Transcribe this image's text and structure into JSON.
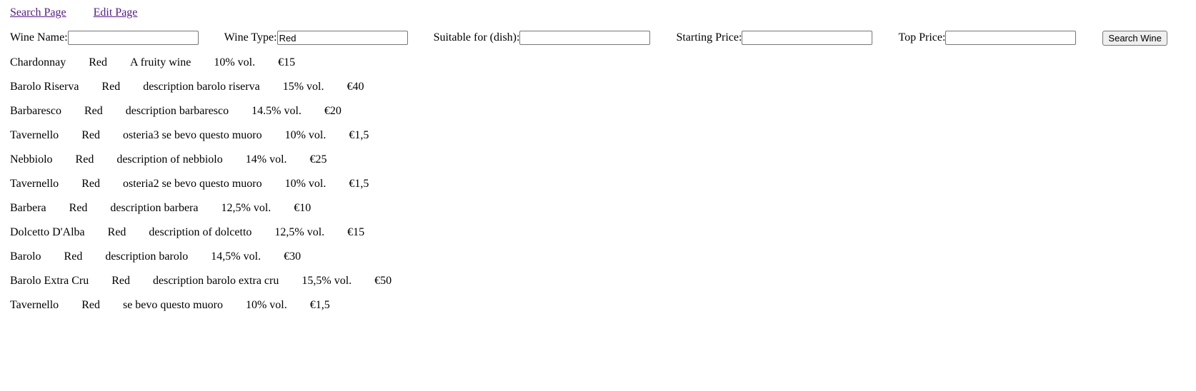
{
  "nav": {
    "search_page": "Search Page",
    "edit_page": "Edit Page"
  },
  "form": {
    "wine_name_label": "Wine Name:",
    "wine_name_value": "",
    "wine_type_label": "Wine Type:",
    "wine_type_value": "Red",
    "dish_label": "Suitable for (dish):",
    "dish_value": "",
    "start_price_label": "Starting Price:",
    "start_price_value": "",
    "top_price_label": "Top Price:",
    "top_price_value": "",
    "search_button": "Search Wine"
  },
  "wines": [
    {
      "name": "Chardonnay",
      "type": "Red",
      "description": "A fruity wine",
      "abv": "10% vol.",
      "price": "€15"
    },
    {
      "name": "Barolo Riserva",
      "type": "Red",
      "description": "description barolo riserva",
      "abv": "15% vol.",
      "price": "€40"
    },
    {
      "name": "Barbaresco",
      "type": "Red",
      "description": "description barbaresco",
      "abv": "14.5% vol.",
      "price": "€20"
    },
    {
      "name": "Tavernello",
      "type": "Red",
      "description": "osteria3 se bevo questo muoro",
      "abv": "10% vol.",
      "price": "€1,5"
    },
    {
      "name": "Nebbiolo",
      "type": "Red",
      "description": "description of nebbiolo",
      "abv": "14% vol.",
      "price": "€25"
    },
    {
      "name": "Tavernello",
      "type": "Red",
      "description": "osteria2 se bevo questo muoro",
      "abv": "10% vol.",
      "price": "€1,5"
    },
    {
      "name": "Barbera",
      "type": "Red",
      "description": "description barbera",
      "abv": "12,5% vol.",
      "price": "€10"
    },
    {
      "name": "Dolcetto D'Alba",
      "type": "Red",
      "description": "description of dolcetto",
      "abv": "12,5% vol.",
      "price": "€15"
    },
    {
      "name": "Barolo",
      "type": "Red",
      "description": "description barolo",
      "abv": "14,5% vol.",
      "price": "€30"
    },
    {
      "name": "Barolo Extra Cru",
      "type": "Red",
      "description": "description barolo extra cru",
      "abv": "15,5% vol.",
      "price": "€50"
    },
    {
      "name": "Tavernello",
      "type": "Red",
      "description": "se bevo questo muoro",
      "abv": "10% vol.",
      "price": "€1,5"
    }
  ]
}
